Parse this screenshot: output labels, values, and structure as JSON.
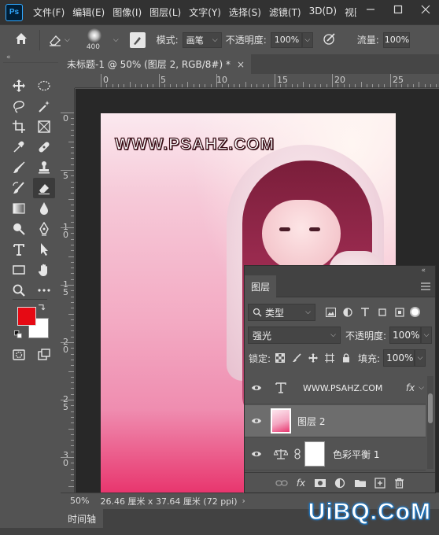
{
  "app": {
    "logo": "Ps",
    "menus": [
      "文件(F)",
      "编辑(E)",
      "图像(I)",
      "图层(L)",
      "文字(Y)",
      "选择(S)",
      "滤镜(T)",
      "3D(D)",
      "视图"
    ]
  },
  "options": {
    "brush_size": "400",
    "mode_label": "模式:",
    "mode_value": "画笔",
    "opacity_label": "不透明度:",
    "opacity_value": "100%",
    "flow_label": "流量:",
    "flow_value": "100%"
  },
  "document": {
    "tab_title": "未标题-1 @ 50% (图层 2, RGB/8#) *",
    "close_glyph": "×",
    "watermark": "WWW.PSAHZ.COM"
  },
  "rulers": {
    "h_labels": [
      "0",
      "5",
      "10",
      "15",
      "20",
      "25"
    ],
    "v_labels": [
      "0",
      "5",
      "1\n0",
      "1\n5",
      "2\n0",
      "2\n5",
      "3\n0"
    ]
  },
  "colors": {
    "foreground": "#e60a14",
    "background": "#ffffff"
  },
  "layers_panel": {
    "collapse_glyph": "«",
    "tab_label": "图层",
    "filter_label": "类型",
    "blend_mode": "强光",
    "opacity_label": "不透明度:",
    "opacity_value": "100%",
    "lock_label": "锁定:",
    "fill_label": "填充:",
    "fill_value": "100%",
    "layers": [
      {
        "name": "WWW.PSAHZ.COM",
        "kind": "text",
        "fx": "fx"
      },
      {
        "name": "图层 2",
        "kind": "pixel",
        "selected": true
      },
      {
        "name": "色彩平衡 1",
        "kind": "adjustment"
      }
    ]
  },
  "status": {
    "zoom": "50%",
    "doc_info": "26.46 厘米 x 37.64 厘米 (72 ppi)",
    "more_glyph": "›"
  },
  "timeline": {
    "tab_label": "时间轴"
  },
  "watermark_site": "UiBQ.CoM"
}
